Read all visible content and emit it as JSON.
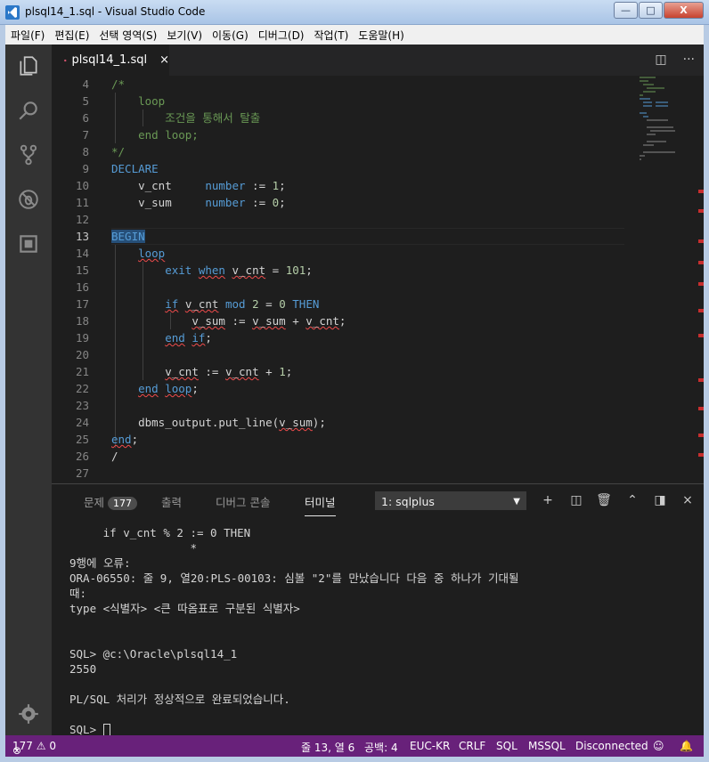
{
  "window": {
    "title": "plsql14_1.sql - Visual Studio Code",
    "minimize": "—",
    "maximize": "□",
    "close": "X"
  },
  "menu": [
    "파일(F)",
    "편집(E)",
    "선택 영역(S)",
    "보기(V)",
    "이동(G)",
    "디버그(D)",
    "작업(T)",
    "도움말(H)"
  ],
  "tab": {
    "filename": "plsql14_1.sql",
    "close": "×"
  },
  "editor": {
    "current_line": 13,
    "lines": [
      {
        "n": "4",
        "t": "/*"
      },
      {
        "n": "5",
        "t": "    loop"
      },
      {
        "n": "6",
        "t": "        조건을 통해서 탈출"
      },
      {
        "n": "7",
        "t": "    end loop;"
      },
      {
        "n": "8",
        "t": "*/"
      },
      {
        "n": "9",
        "t": "DECLARE"
      },
      {
        "n": "10",
        "t": "    v_cnt     number := 1;"
      },
      {
        "n": "11",
        "t": "    v_sum     number := 0;"
      },
      {
        "n": "12",
        "t": ""
      },
      {
        "n": "13",
        "t": "BEGIN"
      },
      {
        "n": "14",
        "t": "    loop"
      },
      {
        "n": "15",
        "t": "        exit when v_cnt = 101;"
      },
      {
        "n": "16",
        "t": ""
      },
      {
        "n": "17",
        "t": "        if v_cnt mod 2 = 0 THEN"
      },
      {
        "n": "18",
        "t": "            v_sum := v_sum + v_cnt;"
      },
      {
        "n": "19",
        "t": "        end if;"
      },
      {
        "n": "20",
        "t": ""
      },
      {
        "n": "21",
        "t": "        v_cnt := v_cnt + 1;"
      },
      {
        "n": "22",
        "t": "    end loop;"
      },
      {
        "n": "23",
        "t": ""
      },
      {
        "n": "24",
        "t": "    dbms_output.put_line(v_sum);"
      },
      {
        "n": "25",
        "t": "end;"
      },
      {
        "n": "26",
        "t": "/"
      },
      {
        "n": "27",
        "t": ""
      }
    ]
  },
  "panel": {
    "tabs": {
      "problems": "문제",
      "problems_count": "177",
      "output": "출력",
      "debug_console": "디버그 콘솔",
      "terminal": "터미널"
    },
    "terminal_select": "1: sqlplus",
    "terminal_lines": [
      "     if v_cnt % 2 := 0 THEN",
      "                  *",
      "9행에 오류:",
      "ORA-06550: 줄 9, 열20:PLS-00103: 심볼 \"2\"를 만났습니다 다음 중 하나가 기대될",
      "때:",
      "type <식별자> <큰 따옴표로 구분된 식별자>",
      "",
      "",
      "SQL> @c:\\Oracle\\plsql14_1",
      "2550",
      "",
      "PL/SQL 처리가 정상적으로 완료되었습니다.",
      "",
      "SQL> "
    ]
  },
  "status": {
    "errors": "177",
    "warnings": "0",
    "position": "줄 13, 열 6",
    "spaces": "공백: 4",
    "encoding": "EUC-KR",
    "eol": "CRLF",
    "language": "SQL",
    "connection_type": "MSSQL",
    "connection_state": "Disconnected"
  },
  "colors": {
    "statusbar": "#68217a",
    "activitybar": "#333333",
    "keyword": "#569cd6",
    "comment": "#6a9955",
    "number": "#b5cea8",
    "error": "#f14c4c"
  },
  "icons": {
    "activity": [
      "files-icon",
      "search-icon",
      "source-control-icon",
      "debug-icon",
      "extensions-icon",
      "settings-gear-icon"
    ]
  }
}
